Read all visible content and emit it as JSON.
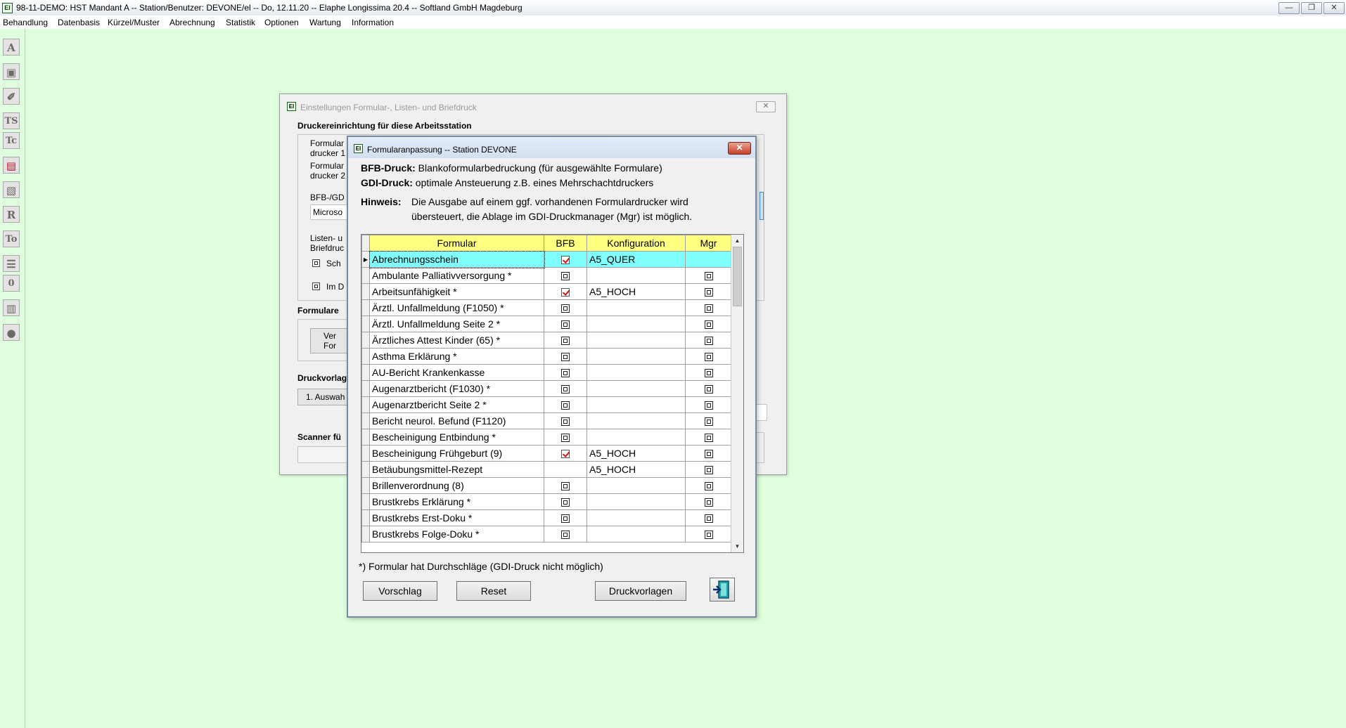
{
  "window": {
    "title": "98-11-DEMO: HST Mandant A -- Station/Benutzer: DEVONE/el -- Do, 12.11.20 -- Elaphe Longissima 20.4 -- Softland GmbH Magdeburg",
    "minimize": "—",
    "restore": "❐",
    "close": "✕"
  },
  "menu": [
    "Behandlung",
    "Datenbasis",
    "Kürzel/Muster",
    "Abrechnung",
    "Statistik",
    "Optionen",
    "Wartung",
    "Information"
  ],
  "left_toolbar": [
    {
      "label": "A",
      "icon": "a-icon"
    },
    {
      "label": "▣",
      "icon": "printer-icon"
    },
    {
      "label": "✐",
      "icon": "edit-icon"
    },
    {
      "label": "TS",
      "icon": "ts-icon"
    },
    {
      "label": "Tc",
      "icon": "tc-icon"
    },
    {
      "label": "▤",
      "icon": "book-icon"
    },
    {
      "label": "▧",
      "icon": "chart-icon"
    },
    {
      "label": "R",
      "icon": "r-icon"
    },
    {
      "label": "To",
      "icon": "to-icon"
    },
    {
      "label": "☰",
      "icon": "stack-icon"
    },
    {
      "label": "0",
      "icon": "zero-icon"
    },
    {
      "label": "▥",
      "icon": "document-icon"
    },
    {
      "label": "●",
      "icon": "disk-icon"
    }
  ],
  "bg_dialog": {
    "title": "Einstellungen Formular-, Listen- und Briefdruck",
    "close": "✕",
    "section_title": "Druckereinrichtung für diese Arbeitsstation",
    "labels": {
      "formular1a": "Formular",
      "formular1b": "drucker 1",
      "formular2a": "Formular",
      "formular2b": "drucker 2",
      "bfb": "BFB-/GD",
      "combo": "Microso",
      "listen_a": "Listen- u",
      "listen_b": "Briefdruc",
      "sch": "Sch",
      "im": "Im D",
      "formulare": "Formulare",
      "btn_ver_a": "Ver",
      "btn_ver_b": "For",
      "druckvorlag": "Druckvorlag",
      "auswahl": "1. Auswah",
      "scanner": "Scanner fü"
    }
  },
  "dialog": {
    "title": "Formularanpassung -- Station DEVONE",
    "close": "✕",
    "info": {
      "bfb_label": "BFB-Druck:",
      "bfb_text": "Blankoformularbedruckung (für ausgewählte Formulare)",
      "gdi_label": "GDI-Druck:",
      "gdi_text": "optimale Ansteuerung z.B. eines Mehrschachtdruckers",
      "hint_label": "Hinweis:",
      "hint_line1": "Die Ausgabe auf einem ggf. vorhandenen Formulardrucker wird",
      "hint_line2": "übersteuert, die Ablage im GDI-Druckmanager (Mgr) ist möglich."
    },
    "columns": [
      "Formular",
      "BFB",
      "Konfiguration",
      "Mgr"
    ],
    "rows": [
      {
        "name": "Abrechnungsschein",
        "bfb": "checked",
        "config": "A5_QUER",
        "mgr": "none",
        "selected": true
      },
      {
        "name": "Ambulante Palliativversorgung *",
        "bfb": "unchecked",
        "config": "",
        "mgr": "unchecked"
      },
      {
        "name": "Arbeitsunfähigkeit *",
        "bfb": "checked",
        "config": "A5_HOCH",
        "mgr": "unchecked"
      },
      {
        "name": "Ärztl. Unfallmeldung (F1050) *",
        "bfb": "unchecked",
        "config": "",
        "mgr": "unchecked"
      },
      {
        "name": "Ärztl. Unfallmeldung Seite 2 *",
        "bfb": "unchecked",
        "config": "",
        "mgr": "unchecked"
      },
      {
        "name": "Ärztliches Attest Kinder (65) *",
        "bfb": "unchecked",
        "config": "",
        "mgr": "unchecked"
      },
      {
        "name": "Asthma Erklärung *",
        "bfb": "unchecked",
        "config": "",
        "mgr": "unchecked"
      },
      {
        "name": "AU-Bericht Krankenkasse",
        "bfb": "unchecked",
        "config": "",
        "mgr": "unchecked"
      },
      {
        "name": "Augenarztbericht (F1030) *",
        "bfb": "unchecked",
        "config": "",
        "mgr": "unchecked"
      },
      {
        "name": "Augenarztbericht Seite 2 *",
        "bfb": "unchecked",
        "config": "",
        "mgr": "unchecked"
      },
      {
        "name": "Bericht neurol. Befund (F1120)",
        "bfb": "unchecked",
        "config": "",
        "mgr": "unchecked"
      },
      {
        "name": "Bescheinigung Entbindung *",
        "bfb": "unchecked",
        "config": "",
        "mgr": "unchecked"
      },
      {
        "name": "Bescheinigung Frühgeburt (9)",
        "bfb": "checked",
        "config": "A5_HOCH",
        "mgr": "unchecked"
      },
      {
        "name": "Betäubungsmittel-Rezept",
        "bfb": "none",
        "config": "A5_HOCH",
        "mgr": "unchecked"
      },
      {
        "name": "Brillenverordnung (8)",
        "bfb": "unchecked",
        "config": "",
        "mgr": "unchecked"
      },
      {
        "name": "Brustkrebs Erklärung *",
        "bfb": "unchecked",
        "config": "",
        "mgr": "unchecked"
      },
      {
        "name": "Brustkrebs Erst-Doku *",
        "bfb": "unchecked",
        "config": "",
        "mgr": "unchecked"
      },
      {
        "name": "Brustkrebs Folge-Doku *",
        "bfb": "unchecked",
        "config": "",
        "mgr": "unchecked"
      }
    ],
    "scroll_up": "▲",
    "scroll_down": "▼",
    "footnote": "*) Formular hat Durchschläge (GDI-Druck nicht möglich)",
    "buttons": {
      "vorschlag": "Vorschlag",
      "reset": "Reset",
      "druckvorlagen": "Druckvorlagen"
    },
    "exit_icon": "exit-door-icon"
  },
  "colors": {
    "desktop": "#dfffdf",
    "grid_header": "#ffff80",
    "grid_selected": "#80ffff",
    "check_mark": "#d41010"
  }
}
